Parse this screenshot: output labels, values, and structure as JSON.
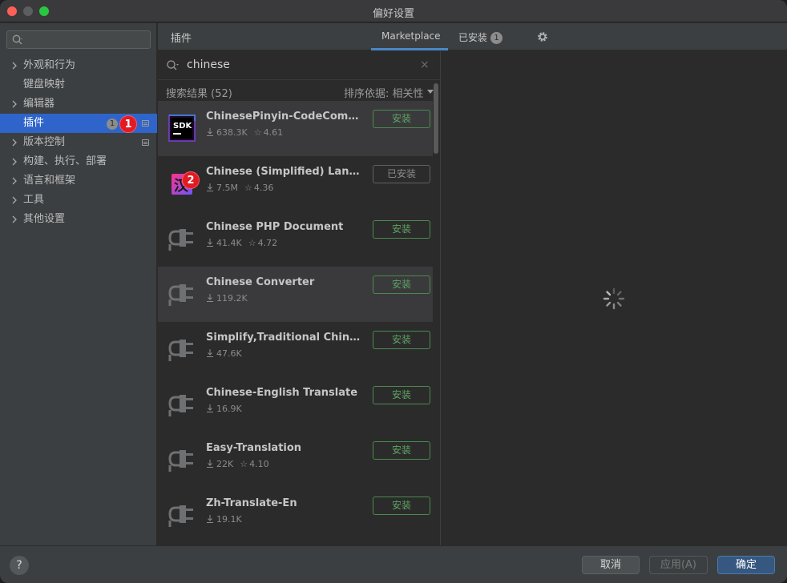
{
  "window": {
    "title": "偏好设置"
  },
  "sidebar": {
    "search_placeholder": "",
    "items": [
      {
        "label": "外观和行为",
        "expandable": true
      },
      {
        "label": "键盘映射",
        "expandable": false
      },
      {
        "label": "编辑器",
        "expandable": true
      },
      {
        "label": "插件",
        "expandable": false,
        "selected": true,
        "badge": "1"
      },
      {
        "label": "版本控制",
        "expandable": true
      },
      {
        "label": "构建、执行、部署",
        "expandable": true
      },
      {
        "label": "语言和框架",
        "expandable": true
      },
      {
        "label": "工具",
        "expandable": true
      },
      {
        "label": "其他设置",
        "expandable": true
      }
    ]
  },
  "header": {
    "section": "插件",
    "tabs": [
      {
        "label": "Marketplace",
        "active": true
      },
      {
        "label": "已安装",
        "count": "1"
      }
    ]
  },
  "search": {
    "query": "chinese",
    "clear": "×"
  },
  "results": {
    "count_label": "搜索结果 (52)",
    "sort_label": "排序依据: 相关性"
  },
  "plugins": [
    {
      "name": "ChinesePinyin-CodeComple...",
      "downloads": "638.3K",
      "rating": "4.61",
      "button": "安装",
      "installed": false,
      "icon": "sdk-icon"
    },
    {
      "name": "Chinese (Simplified) Langua...",
      "downloads": "7.5M",
      "rating": "4.36",
      "button": "已安装",
      "installed": true,
      "icon": "language-pack-icon"
    },
    {
      "name": "Chinese PHP Document",
      "downloads": "41.4K",
      "rating": "4.72",
      "button": "安装",
      "installed": false,
      "icon": "plugin-plug-icon"
    },
    {
      "name": "Chinese Converter",
      "downloads": "119.2K",
      "rating": "",
      "button": "安装",
      "installed": false,
      "icon": "plugin-plug-icon"
    },
    {
      "name": "Simplify,Traditional Chines...",
      "downloads": "47.6K",
      "rating": "",
      "button": "安装",
      "installed": false,
      "icon": "plugin-plug-icon"
    },
    {
      "name": "Chinese-English Translate",
      "downloads": "16.9K",
      "rating": "",
      "button": "安装",
      "installed": false,
      "icon": "plugin-plug-icon"
    },
    {
      "name": "Easy-Translation",
      "downloads": "22K",
      "rating": "4.10",
      "button": "安装",
      "installed": false,
      "icon": "plugin-plug-icon"
    },
    {
      "name": "Zh-Translate-En",
      "downloads": "19.1K",
      "rating": "",
      "button": "安装",
      "installed": false,
      "icon": "plugin-plug-icon"
    }
  ],
  "markers": {
    "one": "1",
    "two": "2"
  },
  "footer": {
    "help": "?",
    "cancel": "取消",
    "apply": "应用(A)",
    "ok": "确定"
  },
  "colors": {
    "selection": "#2f65ca",
    "install_green": "#5fa362",
    "tab_underline": "#4a88c7",
    "ok_button": "#365880",
    "marker_red": "#e11b23"
  }
}
